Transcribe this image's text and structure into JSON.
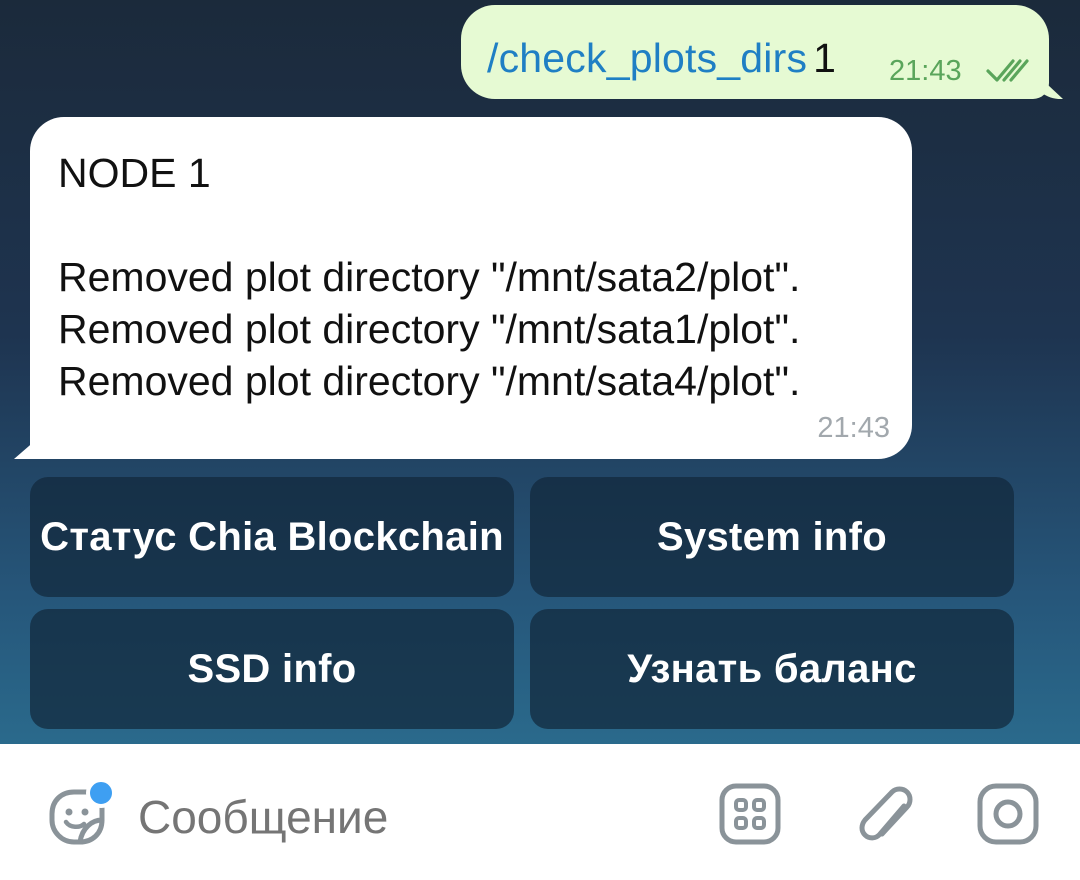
{
  "outgoing": {
    "command": "/check_plots_dirs",
    "argument": "1",
    "time": "21:43",
    "status_icon": "double-check-icon"
  },
  "incoming": {
    "text": "NODE 1\n\nRemoved plot directory \"/mnt/sata2/plot\".\nRemoved plot directory \"/mnt/sata1/plot\".\nRemoved plot directory \"/mnt/sata4/plot\".",
    "time": "21:43"
  },
  "keyboard": {
    "btn1": "Статус Chia Blockchain",
    "btn2": "System info",
    "btn3": "SSD info",
    "btn4": "Узнать баланс"
  },
  "input": {
    "placeholder": "Сообщение",
    "icons": [
      "sticker-icon",
      "bot-commands-icon",
      "attach-icon",
      "camera-icon"
    ],
    "notification_dot_color": "#3e9ff2"
  },
  "colors": {
    "outgoing_bubble": "#e6fad3",
    "command_link": "#1f7fc4",
    "time_out": "#5aa55b"
  }
}
